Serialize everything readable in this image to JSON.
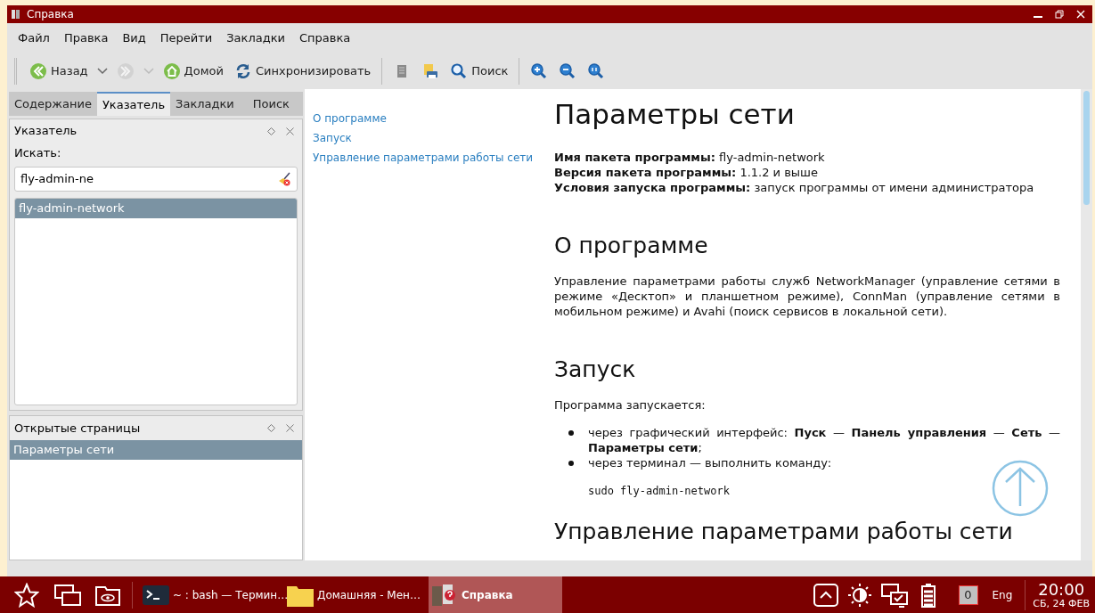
{
  "window": {
    "title": "Справка"
  },
  "menu": [
    "Файл",
    "Правка",
    "Вид",
    "Перейти",
    "Закладки",
    "Справка"
  ],
  "toolbar": [
    {
      "kind": "back",
      "label": "Назад",
      "disabled": false
    },
    {
      "kind": "forward",
      "disabled": true
    },
    {
      "kind": "home",
      "label": "Домой",
      "disabled": false
    },
    {
      "kind": "sync",
      "label": "Синхронизировать",
      "disabled": false
    },
    {
      "kind": "copy",
      "disabled": false
    },
    {
      "kind": "print",
      "disabled": false
    },
    {
      "kind": "search",
      "label": "Поиск",
      "disabled": false
    },
    {
      "kind": "zoom-in",
      "disabled": false
    },
    {
      "kind": "zoom-out",
      "disabled": false
    },
    {
      "kind": "zoom-reset",
      "disabled": false
    }
  ],
  "tabs": [
    {
      "label": "Содержание",
      "selected": false
    },
    {
      "label": "Указатель",
      "selected": true
    },
    {
      "label": "Закладки",
      "selected": false
    },
    {
      "label": "Поиск",
      "selected": false
    }
  ],
  "index_panel": {
    "title": "Указатель",
    "search_label": "Искать:",
    "search_value": "fly-admin-ne",
    "results": [
      {
        "label": "fly-admin-network",
        "selected": true
      }
    ]
  },
  "open_pages": {
    "title": "Открытые страницы",
    "items": [
      {
        "label": "Параметры сети",
        "selected": true
      }
    ]
  },
  "toc": [
    "О программе",
    "Запуск",
    "Управление параметрами работы сети"
  ],
  "article": [
    {
      "kind": "h1",
      "text": "Параметры сети"
    },
    {
      "kind": "lines",
      "lines": [
        "**Имя пакета программы:** fly-admin-network",
        "**Версия пакета программы:** 1.1.2 и выше",
        "**Условия запуска программы:** запуск программы от имени администратора"
      ]
    },
    {
      "kind": "h2",
      "text": "О программе"
    },
    {
      "kind": "p",
      "text": "Управление параметрами работы служб NetworkManager (управление сетями в режиме «Десктоп» и планшетном режиме), ConnMan (управление сетями в мобильном режиме) и Avahi (поиск сервисов в локальной сети)."
    },
    {
      "kind": "h2",
      "text": "Запуск"
    },
    {
      "kind": "p",
      "text": "Программа запускается:"
    },
    {
      "kind": "ul",
      "items": [
        "через графический интерфейс: **Пуск** — **Панель управления** — **Сеть** — **Параметры сети**;",
        "через терминал — выполнить команду:"
      ]
    },
    {
      "kind": "code",
      "text": "sudo fly-admin-network"
    },
    {
      "kind": "h2",
      "text": "Управление параметрами работы сети"
    }
  ],
  "taskbar": {
    "windows": [
      {
        "kind": "terminal",
        "label": "~ : bash — Термин…",
        "active": false
      },
      {
        "kind": "folder",
        "label": "Домашняя - Мен…",
        "active": false
      },
      {
        "kind": "help",
        "label": "Справка",
        "active": true
      }
    ],
    "notifications": "0",
    "language": "Eng",
    "time": "20:00",
    "date": "СБ, 24 ФЕВ"
  }
}
